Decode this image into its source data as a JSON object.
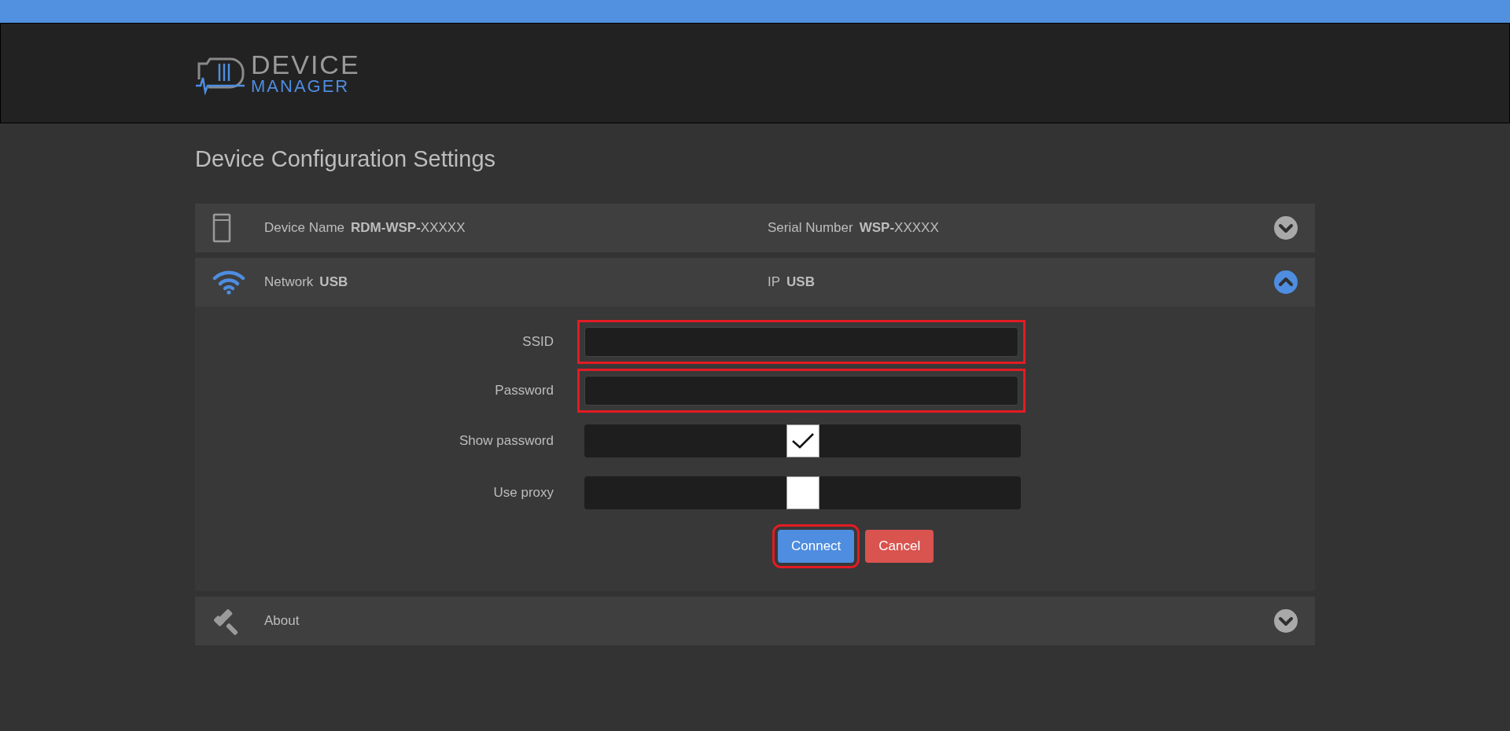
{
  "logo": {
    "line_1": "DEVICE",
    "line_2": "MANAGER"
  },
  "page_title": "Device Configuration Settings",
  "sections": [
    {
      "kind": "device",
      "expanded": false,
      "fields": [
        {
          "label": "Device Name",
          "value": "**RDM-WSP-**XXXXX"
        },
        {
          "label": "Serial Number",
          "value": "**WSP-**XXXXX"
        }
      ]
    },
    {
      "kind": "network",
      "expanded": true,
      "fields": [
        {
          "label": "Network",
          "value": "**USB**"
        },
        {
          "label": "IP",
          "value": "**USB**"
        }
      ],
      "form": {
        "rows": [
          {
            "kind": "text",
            "label": "SSID",
            "value": "",
            "flagged": true
          },
          {
            "kind": "password",
            "label": "Password",
            "value": "",
            "flagged": true
          },
          {
            "kind": "checkbox",
            "label": "Show password",
            "checked": true
          },
          {
            "kind": "checkbox",
            "label": "Use proxy",
            "checked": false
          }
        ],
        "buttons": [
          {
            "kind": "primary",
            "label": "Connect",
            "flagged": true
          },
          {
            "kind": "danger",
            "label": "Cancel",
            "flagged": false
          }
        ]
      }
    },
    {
      "kind": "about",
      "expanded": false,
      "fields": [
        {
          "label": "About"
        }
      ]
    }
  ]
}
